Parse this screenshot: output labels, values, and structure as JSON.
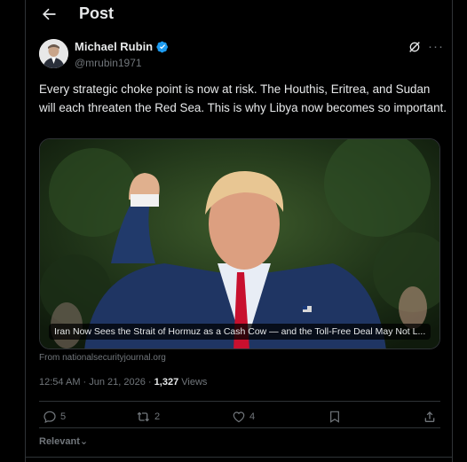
{
  "header": {
    "title": "Post"
  },
  "author": {
    "name": "Michael Rubin",
    "handle": "@mrubin1971"
  },
  "tweet": {
    "text": "Every strategic choke point is now at risk. The Houthis, Eritrea, and Sudan will each threaten the Red Sea. This is why Libya now becomes so important."
  },
  "card": {
    "caption": "Iran Now Sees the Strait of Hormuz as a Cash Cow — and the Toll-Free Deal May Not L...",
    "source": "From nationalsecurityjournal.org"
  },
  "meta": {
    "timestamp": "12:54 AM · Jun 21, 2026",
    "separator": " · ",
    "views_count": "1,327",
    "views_label": " Views"
  },
  "actions": {
    "replies": "5",
    "reposts": "2",
    "likes": "4"
  },
  "sort": {
    "label": "Relevant"
  },
  "colors": {
    "background": "#000000",
    "text": "#e7e9ea",
    "muted": "#71767b",
    "verified": "#1d9bf0",
    "border": "#2f3336"
  }
}
